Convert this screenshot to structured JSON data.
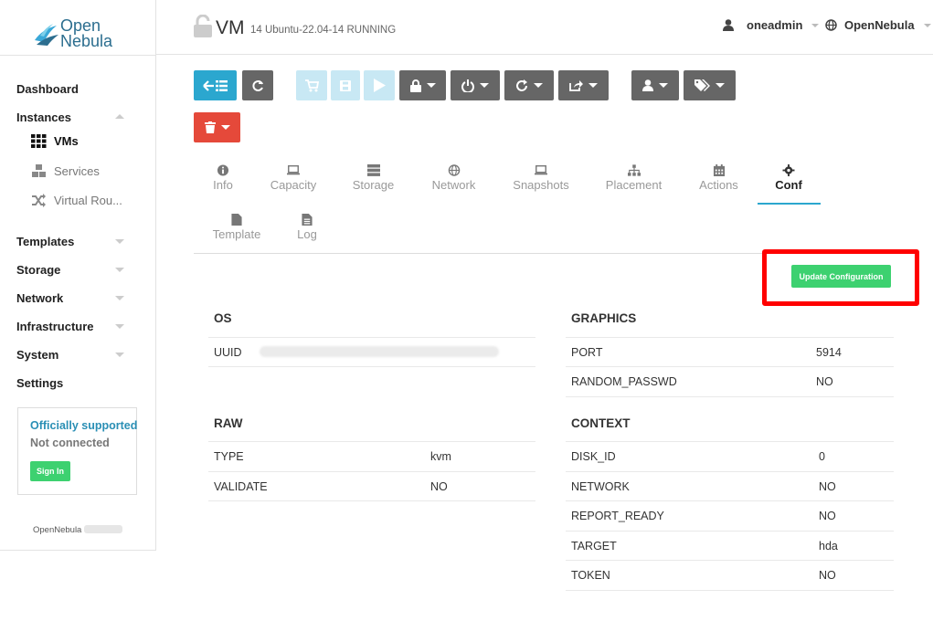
{
  "brand": {
    "line1": "Open",
    "line2": "Nebula"
  },
  "sidebar": {
    "items": [
      {
        "label": "Dashboard"
      },
      {
        "label": "Instances"
      },
      {
        "label": "Templates"
      },
      {
        "label": "Storage"
      },
      {
        "label": "Network"
      },
      {
        "label": "Infrastructure"
      },
      {
        "label": "System"
      },
      {
        "label": "Settings"
      }
    ],
    "sub_items": [
      {
        "label": "VMs",
        "icon": "grid-icon"
      },
      {
        "label": "Services",
        "icon": "cubes-icon"
      },
      {
        "label": "Virtual Rou...",
        "icon": "shuffle-icon"
      }
    ],
    "support": {
      "title": "Officially supported",
      "status": "Not connected",
      "signin_label": "Sign In"
    },
    "version_label": "OpenNebula"
  },
  "header": {
    "title": "VM",
    "meta": "14  Ubuntu-22.04-14  RUNNING",
    "user": "oneadmin",
    "zone": "OpenNebula"
  },
  "tabs": [
    {
      "label": "Info",
      "icon": "info-icon"
    },
    {
      "label": "Capacity",
      "icon": "laptop-icon"
    },
    {
      "label": "Storage",
      "icon": "server-icon"
    },
    {
      "label": "Network",
      "icon": "globe-icon"
    },
    {
      "label": "Snapshots",
      "icon": "laptop-icon"
    },
    {
      "label": "Placement",
      "icon": "sitemap-icon"
    },
    {
      "label": "Actions",
      "icon": "calendar-icon"
    },
    {
      "label": "Conf",
      "icon": "gear-icon"
    },
    {
      "label": "Template",
      "icon": "file-icon"
    },
    {
      "label": "Log",
      "icon": "file-text-icon"
    }
  ],
  "update_label": "Update Configuration",
  "os": {
    "title": "OS",
    "rows": [
      {
        "key": "UUID",
        "value": ""
      }
    ]
  },
  "raw": {
    "title": "RAW",
    "rows": [
      {
        "key": "TYPE",
        "value": "kvm"
      },
      {
        "key": "VALIDATE",
        "value": "NO"
      }
    ]
  },
  "graphics": {
    "title": "GRAPHICS",
    "rows": [
      {
        "key": "PORT",
        "value": "5914"
      },
      {
        "key": "RANDOM_PASSWD",
        "value": "NO"
      }
    ]
  },
  "context": {
    "title": "CONTEXT",
    "rows": [
      {
        "key": "DISK_ID",
        "value": "0"
      },
      {
        "key": "NETWORK",
        "value": "NO"
      },
      {
        "key": "REPORT_READY",
        "value": "NO"
      },
      {
        "key": "TARGET",
        "value": "hda"
      },
      {
        "key": "TOKEN",
        "value": "NO"
      }
    ]
  }
}
